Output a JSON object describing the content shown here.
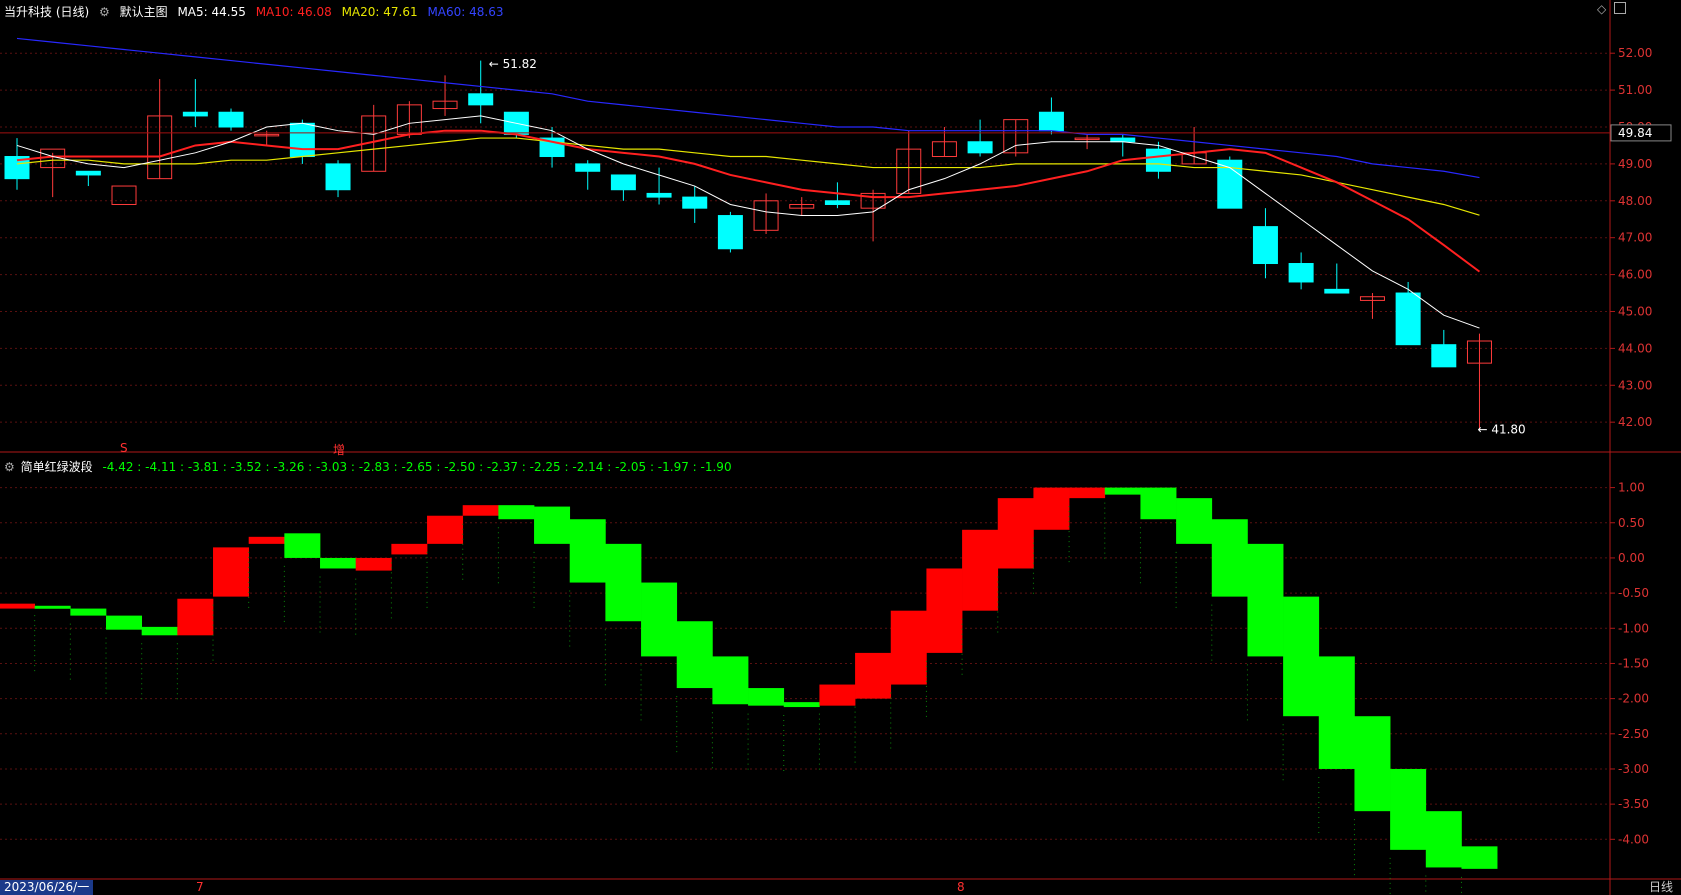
{
  "header": {
    "stock": "当升科技 (日线)",
    "indicator_name": "默认主图",
    "ma5": "MA5: 44.55",
    "ma10": "MA10: 46.08",
    "ma20": "MA20: 47.61",
    "ma60": "MA60: 48.63"
  },
  "sub_header": {
    "name": "简单红绿波段",
    "values": "-4.42 : -4.11 : -3.81 : -3.52 : -3.26 : -3.03 : -2.83 : -2.65 : -2.50 : -2.37 : -2.25 : -2.14 : -2.05 : -1.97 : -1.90"
  },
  "footer": {
    "date": "2023/06/26/一",
    "period": "日线",
    "month7": "7",
    "month8": "8"
  },
  "markers": {
    "s": "S",
    "zeng": "增"
  },
  "colors": {
    "up": "#ff3b3b",
    "down": "#00ffff",
    "ma5": "#ffffff",
    "ma10": "#ff2020",
    "ma20": "#e6e600",
    "ma60": "#2828ff",
    "wave_red": "#ff0000",
    "wave_green": "#00ff00"
  },
  "chart_data": [
    {
      "type": "candlestick",
      "y_ticks": [
        "52.00",
        "51.00",
        "50.00",
        "49.00",
        "48.00",
        "47.00",
        "46.00",
        "45.00",
        "44.00",
        "43.00",
        "42.00"
      ],
      "ylim": [
        41.3,
        52.9
      ],
      "current_price_label": "49.84",
      "high_label": "51.82",
      "low_label": "41.80",
      "candles": [
        [
          49.2,
          48.6,
          49.7,
          48.3
        ],
        [
          48.9,
          49.4,
          49.3,
          48.1
        ],
        [
          48.8,
          48.7,
          48.8,
          48.4
        ],
        [
          47.9,
          48.4,
          47.8,
          47.8
        ],
        [
          48.6,
          50.3,
          51.3,
          48.6
        ],
        [
          50.4,
          50.3,
          51.3,
          50.0
        ],
        [
          50.4,
          50.0,
          50.5,
          49.9
        ],
        [
          49.8,
          49.8,
          49.9,
          49.5
        ],
        [
          50.1,
          49.2,
          50.2,
          49.0
        ],
        [
          49.0,
          48.3,
          49.1,
          48.1
        ],
        [
          48.8,
          50.3,
          50.6,
          48.8
        ],
        [
          49.8,
          50.6,
          50.7,
          49.7
        ],
        [
          50.5,
          50.7,
          51.4,
          50.3
        ],
        [
          50.9,
          50.6,
          51.8,
          50.1
        ],
        [
          50.4,
          49.8,
          50.4,
          49.7
        ],
        [
          49.7,
          49.2,
          50.0,
          48.9
        ],
        [
          49.0,
          48.8,
          49.1,
          48.3
        ],
        [
          48.7,
          48.3,
          48.7,
          48.0
        ],
        [
          48.2,
          48.1,
          48.9,
          47.9
        ],
        [
          48.1,
          47.8,
          48.4,
          47.4
        ],
        [
          47.6,
          46.7,
          47.7,
          46.6
        ],
        [
          47.2,
          48.0,
          48.2,
          47.1
        ],
        [
          47.8,
          47.9,
          48.1,
          47.6
        ],
        [
          48.0,
          47.9,
          48.5,
          47.8
        ],
        [
          47.8,
          48.2,
          48.3,
          46.9
        ],
        [
          48.2,
          49.4,
          49.9,
          48.2
        ],
        [
          49.2,
          49.6,
          50.0,
          49.2
        ],
        [
          49.6,
          49.3,
          50.2,
          49.2
        ],
        [
          49.3,
          50.2,
          50.2,
          49.2
        ],
        [
          50.4,
          49.9,
          50.8,
          49.8
        ],
        [
          49.7,
          49.7,
          49.8,
          49.4
        ],
        [
          49.7,
          49.6,
          49.8,
          49.2
        ],
        [
          49.4,
          48.8,
          49.6,
          48.6
        ],
        [
          49.0,
          49.3,
          50.0,
          49.0
        ],
        [
          49.1,
          47.8,
          49.2,
          47.8
        ],
        [
          47.3,
          46.3,
          47.8,
          45.9
        ],
        [
          46.3,
          45.8,
          46.6,
          45.6
        ],
        [
          45.6,
          45.5,
          46.3,
          45.5
        ],
        [
          45.3,
          45.4,
          45.5,
          44.8
        ],
        [
          45.5,
          44.1,
          45.8,
          44.1
        ],
        [
          44.1,
          43.5,
          44.5,
          43.5
        ],
        [
          43.6,
          44.2,
          44.4,
          41.8
        ]
      ],
      "ma5": [
        49.5,
        49.2,
        49.0,
        48.9,
        49.1,
        49.3,
        49.6,
        50.0,
        50.1,
        49.9,
        49.8,
        50.1,
        50.2,
        50.3,
        50.1,
        49.9,
        49.4,
        49.0,
        48.7,
        48.4,
        47.9,
        47.7,
        47.6,
        47.6,
        47.7,
        48.3,
        48.6,
        49.0,
        49.5,
        49.6,
        49.6,
        49.6,
        49.5,
        49.2,
        48.9,
        48.2,
        47.5,
        46.8,
        46.1,
        45.6,
        44.9,
        44.55
      ],
      "ma10": [
        49.1,
        49.2,
        49.2,
        49.2,
        49.2,
        49.5,
        49.6,
        49.5,
        49.4,
        49.4,
        49.6,
        49.8,
        49.9,
        49.9,
        49.8,
        49.6,
        49.4,
        49.3,
        49.2,
        49.0,
        48.7,
        48.5,
        48.3,
        48.2,
        48.1,
        48.1,
        48.2,
        48.3,
        48.4,
        48.6,
        48.8,
        49.1,
        49.2,
        49.3,
        49.4,
        49.3,
        48.9,
        48.5,
        48.0,
        47.5,
        46.8,
        46.08
      ],
      "ma20": [
        49.0,
        49.1,
        49.1,
        49.0,
        49.0,
        49.0,
        49.1,
        49.1,
        49.2,
        49.3,
        49.4,
        49.5,
        49.6,
        49.7,
        49.7,
        49.6,
        49.5,
        49.4,
        49.4,
        49.3,
        49.2,
        49.2,
        49.1,
        49.0,
        48.9,
        48.9,
        48.9,
        48.9,
        49.0,
        49.0,
        49.0,
        49.0,
        49.0,
        48.9,
        48.9,
        48.8,
        48.7,
        48.5,
        48.3,
        48.1,
        47.9,
        47.61
      ],
      "ma60": [
        52.4,
        52.3,
        52.2,
        52.1,
        52.0,
        51.9,
        51.8,
        51.7,
        51.6,
        51.5,
        51.4,
        51.3,
        51.2,
        51.1,
        51.0,
        50.9,
        50.7,
        50.6,
        50.5,
        50.4,
        50.3,
        50.2,
        50.1,
        50.0,
        50.0,
        49.9,
        49.9,
        49.9,
        49.9,
        49.9,
        49.8,
        49.8,
        49.7,
        49.6,
        49.5,
        49.4,
        49.3,
        49.2,
        49.0,
        48.9,
        48.8,
        48.63
      ]
    },
    {
      "type": "step-wave",
      "y_ticks": [
        "1.00",
        "0.50",
        "0.00",
        "-0.50",
        "-1.00",
        "-1.50",
        "-2.00",
        "-2.50",
        "-3.00",
        "-3.50",
        "-4.00"
      ],
      "ylim": [
        -4.55,
        1.25
      ],
      "bars": [
        [
          -0.65,
          -0.72,
          "r"
        ],
        [
          -0.68,
          -0.7,
          "g"
        ],
        [
          -0.72,
          -0.82,
          "g"
        ],
        [
          -0.82,
          -1.02,
          "g"
        ],
        [
          -0.98,
          -1.1,
          "g"
        ],
        [
          -1.1,
          -0.58,
          "r"
        ],
        [
          -0.55,
          0.15,
          "r"
        ],
        [
          0.3,
          0.2,
          "r"
        ],
        [
          0.35,
          0.0,
          "g"
        ],
        [
          0.0,
          -0.15,
          "g"
        ],
        [
          -0.18,
          0.0,
          "r"
        ],
        [
          0.05,
          0.2,
          "r"
        ],
        [
          0.2,
          0.6,
          "r"
        ],
        [
          0.6,
          0.75,
          "r"
        ],
        [
          0.75,
          0.55,
          "g"
        ],
        [
          0.73,
          0.2,
          "g"
        ],
        [
          0.55,
          -0.35,
          "g"
        ],
        [
          0.2,
          -0.9,
          "g"
        ],
        [
          -0.35,
          -1.4,
          "g"
        ],
        [
          -0.9,
          -1.85,
          "g"
        ],
        [
          -1.4,
          -2.08,
          "g"
        ],
        [
          -1.85,
          -2.1,
          "g"
        ],
        [
          -2.05,
          -2.12,
          "g"
        ],
        [
          -2.1,
          -1.8,
          "r"
        ],
        [
          -2.0,
          -1.35,
          "r"
        ],
        [
          -1.8,
          -0.75,
          "r"
        ],
        [
          -1.35,
          -0.15,
          "r"
        ],
        [
          -0.75,
          0.4,
          "r"
        ],
        [
          -0.15,
          0.85,
          "r"
        ],
        [
          0.4,
          1.0,
          "r"
        ],
        [
          0.85,
          1.0,
          "r"
        ],
        [
          1.0,
          0.9,
          "g"
        ],
        [
          1.0,
          0.55,
          "g"
        ],
        [
          0.85,
          0.2,
          "g"
        ],
        [
          0.55,
          -0.55,
          "g"
        ],
        [
          0.2,
          -1.4,
          "g"
        ],
        [
          -0.55,
          -2.25,
          "g"
        ],
        [
          -1.4,
          -3.0,
          "g"
        ],
        [
          -2.25,
          -3.6,
          "g"
        ],
        [
          -3.0,
          -4.15,
          "g"
        ],
        [
          -3.6,
          -4.4,
          "g"
        ],
        [
          -4.1,
          -4.42,
          "g"
        ]
      ]
    }
  ]
}
